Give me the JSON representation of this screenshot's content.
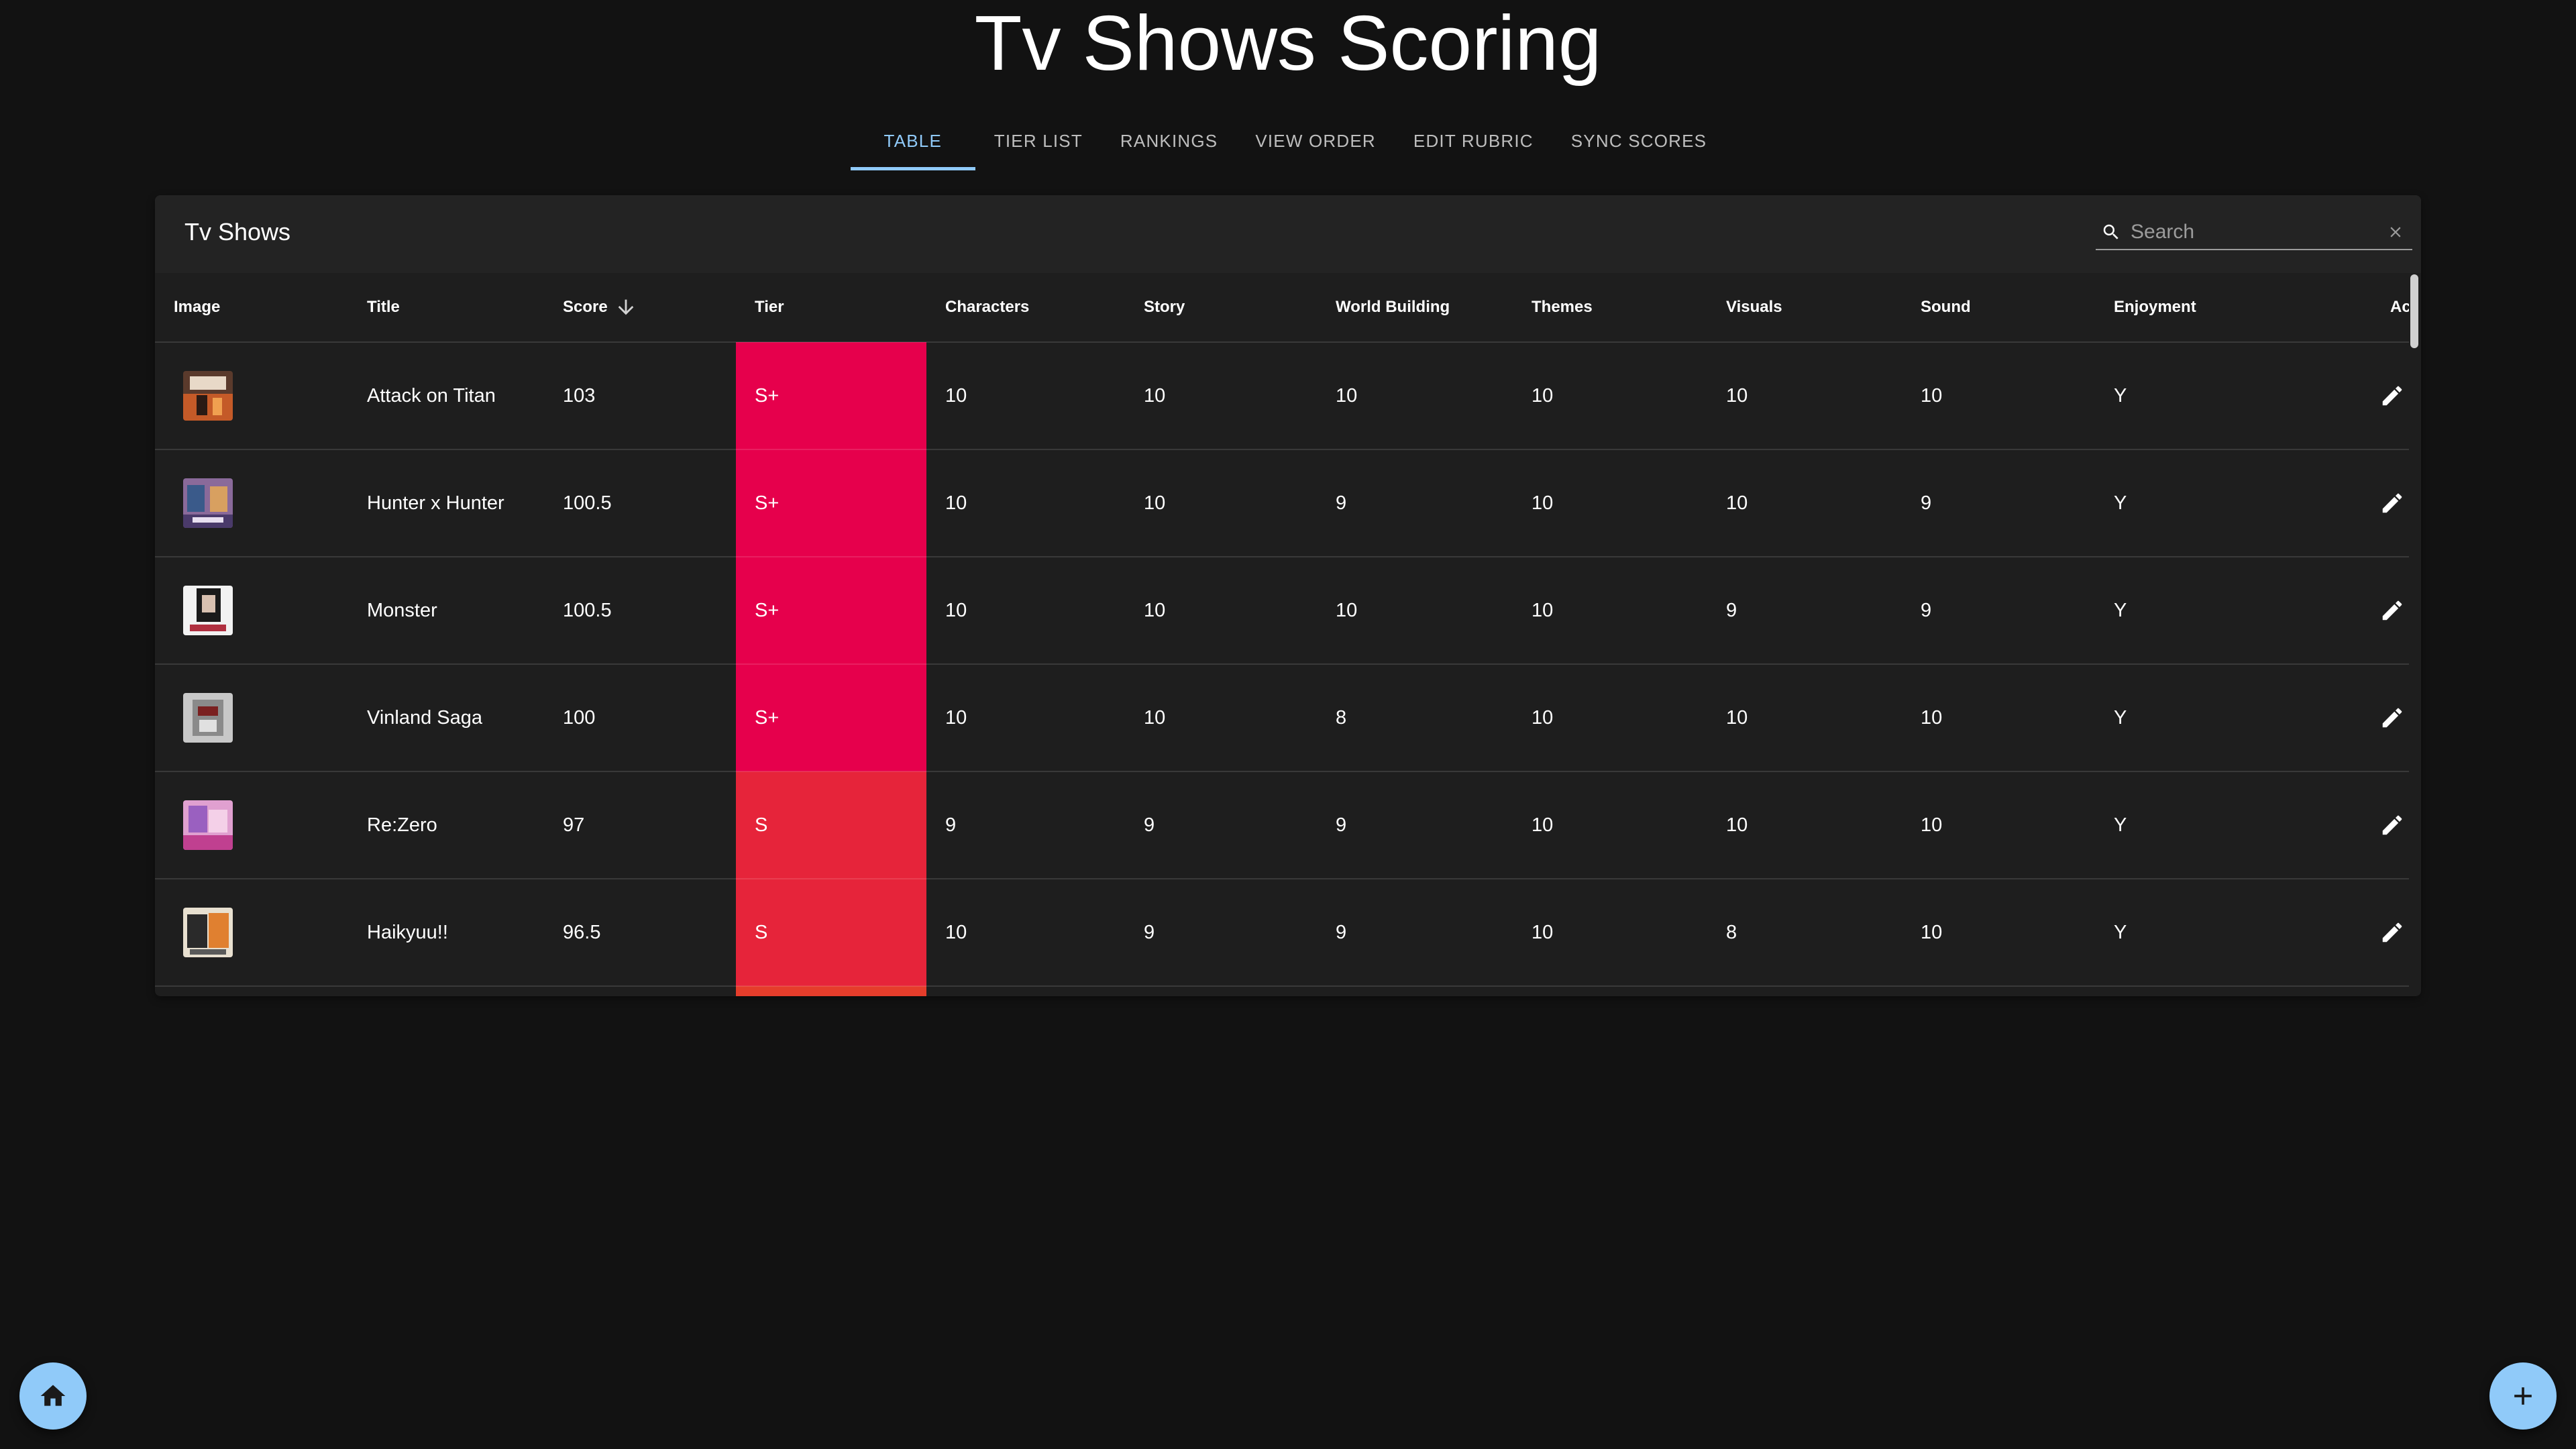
{
  "page": {
    "title": "Tv Shows Scoring"
  },
  "tabs": [
    {
      "label": "TABLE",
      "active": true
    },
    {
      "label": "TIER LIST",
      "active": false
    },
    {
      "label": "RANKINGS",
      "active": false
    },
    {
      "label": "VIEW ORDER",
      "active": false
    },
    {
      "label": "EDIT RUBRIC",
      "active": false
    },
    {
      "label": "SYNC SCORES",
      "active": false
    }
  ],
  "table": {
    "title": "Tv Shows",
    "search_placeholder": "Search",
    "columns": [
      "Image",
      "Title",
      "Score",
      "Tier",
      "Characters",
      "Story",
      "World Building",
      "Themes",
      "Visuals",
      "Sound",
      "Enjoyment",
      "Actions"
    ],
    "sorted_column": "Score",
    "sort_direction": "descending",
    "rows": [
      {
        "title": "Attack on Titan",
        "score": "103",
        "tier": "S+",
        "characters": "10",
        "story": "10",
        "world_building": "10",
        "themes": "10",
        "visuals": "10",
        "sound": "10",
        "enjoyment": "Y"
      },
      {
        "title": "Hunter x Hunter",
        "score": "100.5",
        "tier": "S+",
        "characters": "10",
        "story": "10",
        "world_building": "9",
        "themes": "10",
        "visuals": "10",
        "sound": "9",
        "enjoyment": "Y"
      },
      {
        "title": "Monster",
        "score": "100.5",
        "tier": "S+",
        "characters": "10",
        "story": "10",
        "world_building": "10",
        "themes": "10",
        "visuals": "9",
        "sound": "9",
        "enjoyment": "Y"
      },
      {
        "title": "Vinland Saga",
        "score": "100",
        "tier": "S+",
        "characters": "10",
        "story": "10",
        "world_building": "8",
        "themes": "10",
        "visuals": "10",
        "sound": "10",
        "enjoyment": "Y"
      },
      {
        "title": "Re:Zero",
        "score": "97",
        "tier": "S",
        "characters": "9",
        "story": "9",
        "world_building": "9",
        "themes": "10",
        "visuals": "10",
        "sound": "10",
        "enjoyment": "Y"
      },
      {
        "title": "Haikyuu!!",
        "score": "96.5",
        "tier": "S",
        "characters": "10",
        "story": "9",
        "world_building": "9",
        "themes": "10",
        "visuals": "8",
        "sound": "10",
        "enjoyment": "Y"
      }
    ]
  },
  "colors": {
    "accent": "#90caf9",
    "tier_s_plus": "#e6004c",
    "tier_s": "#e6243a",
    "tier_next": "#e53d2b",
    "background": "#121212",
    "surface": "#1e1e1e"
  },
  "icons": {
    "search": "search-icon",
    "clear": "close-icon",
    "sort": "arrow-down-icon",
    "edit": "pencil-icon",
    "delete": "trash-icon",
    "home": "home-icon",
    "add": "plus-icon"
  }
}
